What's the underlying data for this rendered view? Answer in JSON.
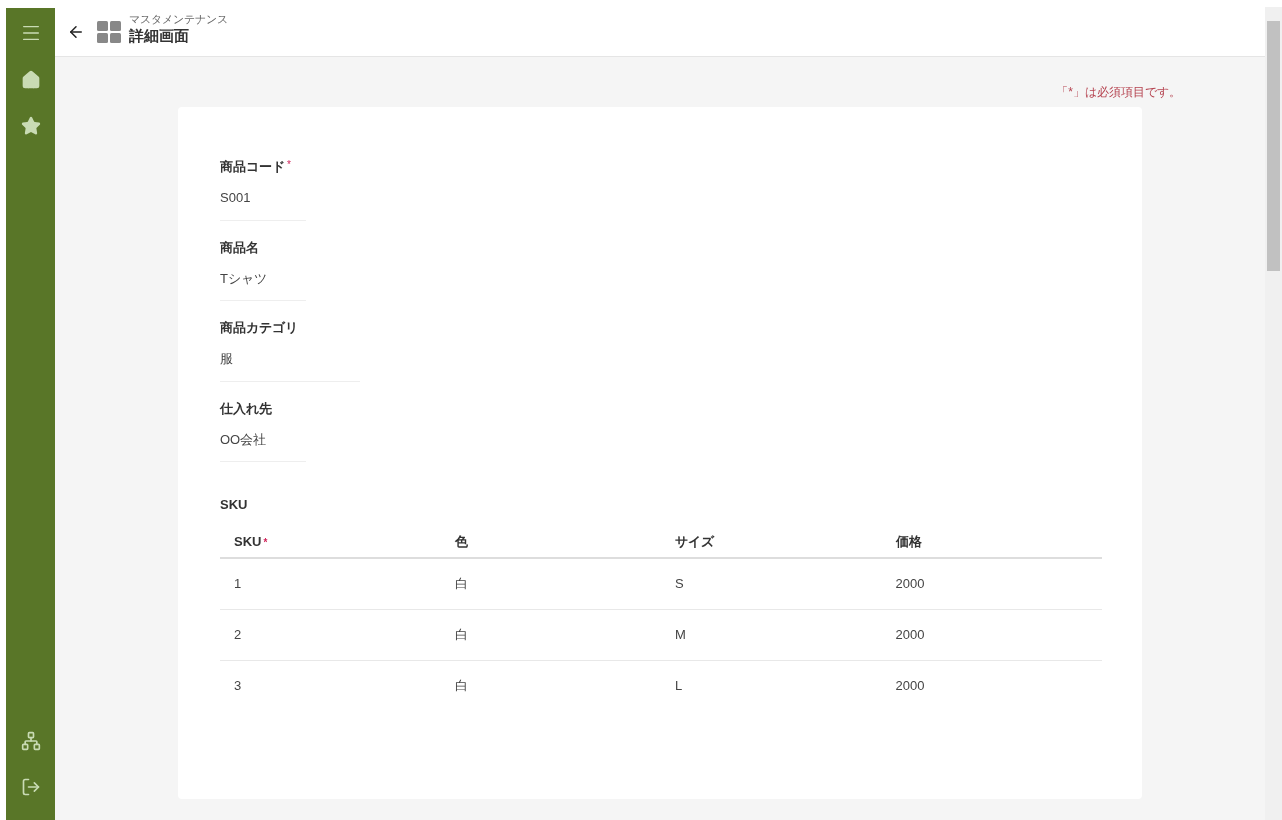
{
  "header": {
    "breadcrumb": "マスタメンテナンス",
    "title": "詳細画面"
  },
  "sidebar": {
    "top_items": [
      {
        "kind": "menu"
      },
      {
        "kind": "home"
      },
      {
        "kind": "favorite"
      }
    ],
    "bottom_items": [
      {
        "kind": "sitemap"
      },
      {
        "kind": "logout"
      }
    ]
  },
  "required_note": "「*」は必須項目です。",
  "required_mark": "*",
  "fields": [
    {
      "label": "商品コード",
      "required": true,
      "value": "S001",
      "wide": false
    },
    {
      "label": "商品名",
      "required": false,
      "value": "Tシャツ",
      "wide": false
    },
    {
      "label": "商品カテゴリ",
      "required": false,
      "value": "服",
      "wide": true
    },
    {
      "label": "仕入れ先",
      "required": false,
      "value": "OO会社",
      "wide": false
    }
  ],
  "sku": {
    "title": "SKU",
    "columns": [
      {
        "label": "SKU",
        "required": true
      },
      {
        "label": "色",
        "required": false
      },
      {
        "label": "サイズ",
        "required": false
      },
      {
        "label": "価格",
        "required": false
      }
    ],
    "rows": [
      [
        "1",
        "白",
        "S",
        "2000"
      ],
      [
        "2",
        "白",
        "M",
        "2000"
      ],
      [
        "3",
        "白",
        "L",
        "2000"
      ]
    ]
  }
}
